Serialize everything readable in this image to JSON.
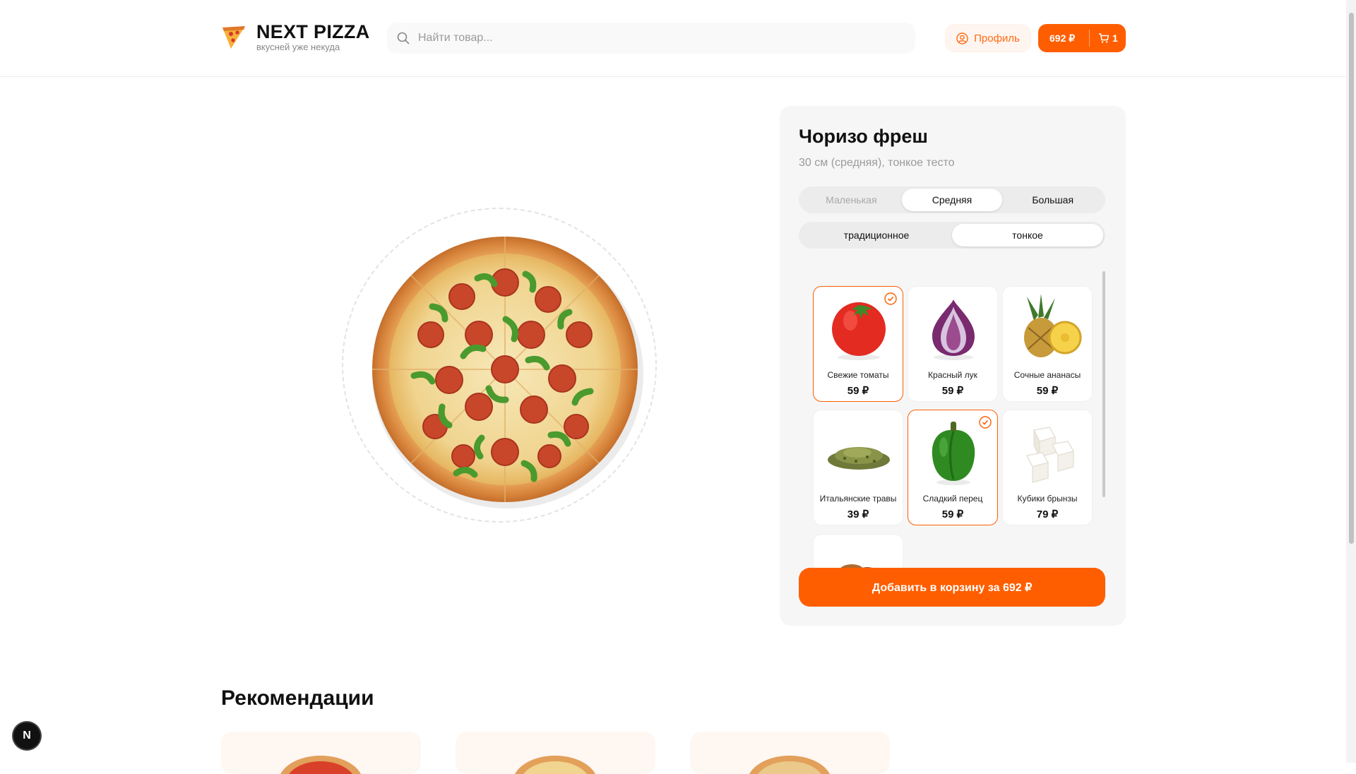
{
  "header": {
    "logo_title": "NEXT PIZZA",
    "logo_subtitle": "вкусней уже некуда",
    "search_placeholder": "Найти товар...",
    "profile_label": "Профиль",
    "cart_total": "692 ₽",
    "cart_count": "1"
  },
  "product": {
    "title": "Чоризо фреш",
    "subtitle": "30 см (средняя), тонкое тесто",
    "sizes": [
      {
        "label": "Маленькая",
        "state": "disabled"
      },
      {
        "label": "Средняя",
        "state": "active"
      },
      {
        "label": "Большая",
        "state": "normal"
      }
    ],
    "dough": [
      {
        "label": "традиционное",
        "state": "normal"
      },
      {
        "label": "тонкое",
        "state": "active"
      }
    ],
    "ingredients": [
      {
        "name": "Свежие томаты",
        "price": "59 ₽",
        "selected": true,
        "icon": "tomato-icon"
      },
      {
        "name": "Красный лук",
        "price": "59 ₽",
        "selected": false,
        "icon": "red-onion-icon"
      },
      {
        "name": "Сочные ананасы",
        "price": "59 ₽",
        "selected": false,
        "icon": "pineapple-icon"
      },
      {
        "name": "Итальянские травы",
        "price": "39 ₽",
        "selected": false,
        "icon": "herbs-icon"
      },
      {
        "name": "Сладкий перец",
        "price": "59 ₽",
        "selected": true,
        "icon": "bell-pepper-icon"
      },
      {
        "name": "Кубики брынзы",
        "price": "79 ₽",
        "selected": false,
        "icon": "cheese-cubes-icon"
      }
    ],
    "add_button": "Добавить в корзину за 692 ₽"
  },
  "recommendations": {
    "title": "Рекомендации"
  },
  "badge": "N",
  "colors": {
    "accent": "#ff5e00",
    "panel_bg": "#f6f6f6"
  }
}
